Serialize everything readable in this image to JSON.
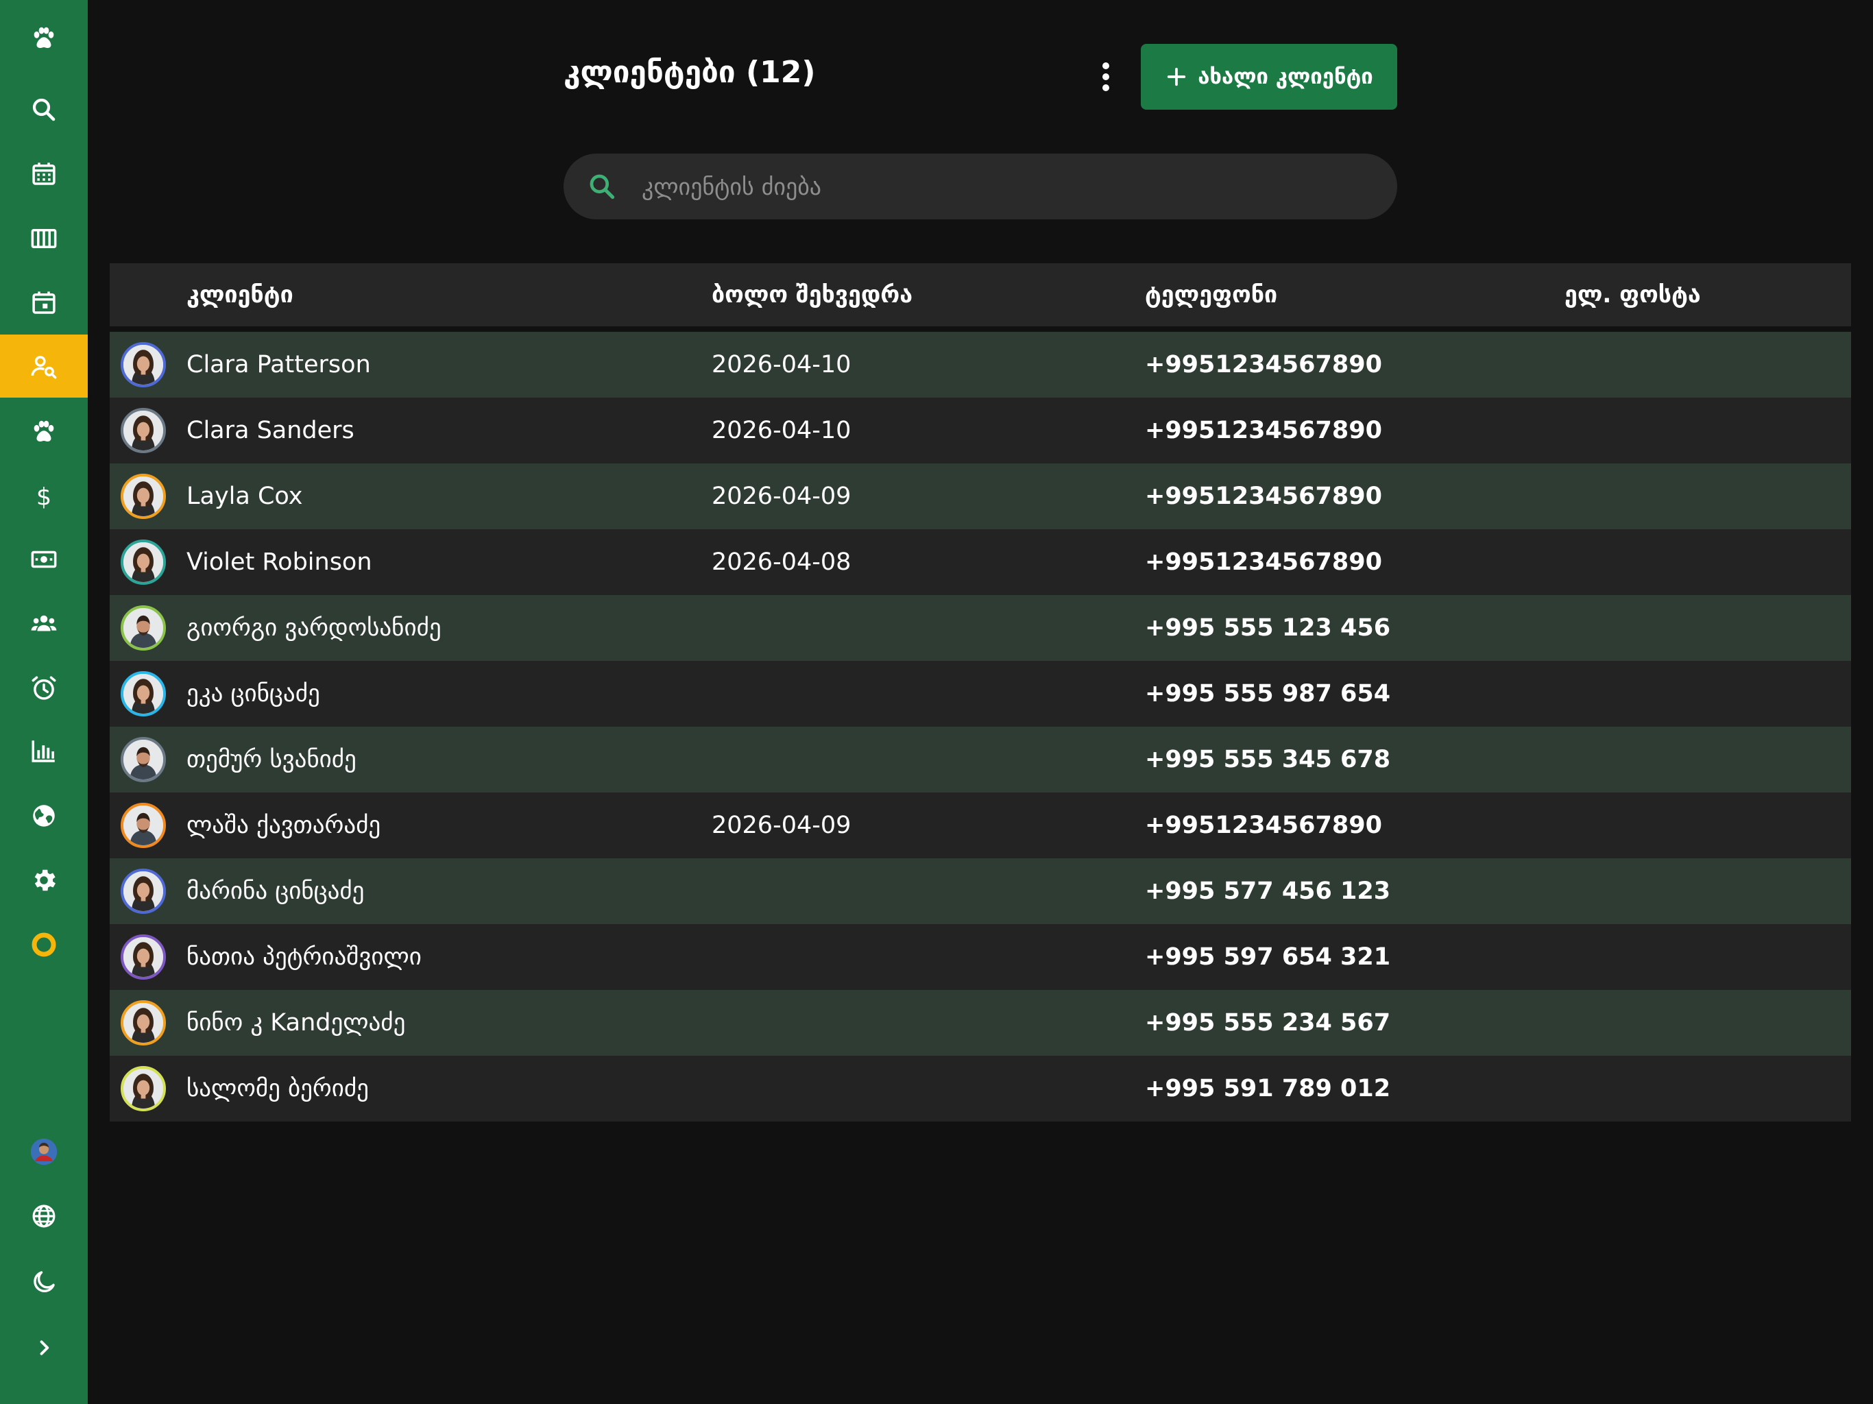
{
  "header": {
    "title": "კლიენტები (12)",
    "add_button_label": "ახალი კლიენტი"
  },
  "search": {
    "placeholder": "კლიენტის ძიება",
    "value": ""
  },
  "sidebar": {
    "items": [
      {
        "icon": "paw-icon",
        "active": false
      },
      {
        "icon": "search-icon",
        "active": false
      },
      {
        "icon": "calendar-grid-icon",
        "active": false
      },
      {
        "icon": "columns-icon",
        "active": false
      },
      {
        "icon": "calendar-event-icon",
        "active": false
      },
      {
        "icon": "client-search-icon",
        "active": true
      },
      {
        "icon": "paw-icon",
        "active": false
      },
      {
        "icon": "dollar-icon",
        "active": false
      },
      {
        "icon": "cash-icon",
        "active": false
      },
      {
        "icon": "group-icon",
        "active": false
      },
      {
        "icon": "alarm-icon",
        "active": false
      },
      {
        "icon": "bar-chart-icon",
        "active": false
      },
      {
        "icon": "globe-icon",
        "active": false
      },
      {
        "icon": "gear-icon",
        "active": false
      },
      {
        "icon": "donut-icon",
        "active": false
      }
    ],
    "bottom": [
      {
        "icon": "avatar"
      },
      {
        "icon": "language-globe-icon"
      },
      {
        "icon": "moon-icon"
      },
      {
        "icon": "chevron-right-icon"
      }
    ]
  },
  "table": {
    "columns": [
      "კლიენტი",
      "ბოლო შეხვედრა",
      "ტელეფონი",
      "ელ. ფოსტა"
    ],
    "rows": [
      {
        "name": "Clara Patterson",
        "last_visit": "2026-04-10",
        "phone": "+9951234567890",
        "email": "",
        "avatar_color": "#4f6ad6",
        "gender": "f"
      },
      {
        "name": "Clara Sanders",
        "last_visit": "2026-04-10",
        "phone": "+9951234567890",
        "email": "",
        "avatar_color": "#6b7a86",
        "gender": "f"
      },
      {
        "name": "Layla Cox",
        "last_visit": "2026-04-09",
        "phone": "+9951234567890",
        "email": "",
        "avatar_color": "#f0a01e",
        "gender": "f"
      },
      {
        "name": "Violet Robinson",
        "last_visit": "2026-04-08",
        "phone": "+9951234567890",
        "email": "",
        "avatar_color": "#2aa598",
        "gender": "f"
      },
      {
        "name": "გიორგი ვარდოსანიძე",
        "last_visit": "",
        "phone": "+995 555 123 456",
        "email": "",
        "avatar_color": "#8bc34a",
        "gender": "m"
      },
      {
        "name": "ეკა ცინცაძე",
        "last_visit": "",
        "phone": "+995 555 987 654",
        "email": "",
        "avatar_color": "#29b6e8",
        "gender": "f"
      },
      {
        "name": "თემურ სვანიძე",
        "last_visit": "",
        "phone": "+995 555 345 678",
        "email": "",
        "avatar_color": "#6b7a86",
        "gender": "m"
      },
      {
        "name": "ლაშა ქავთარაძე",
        "last_visit": "2026-04-09",
        "phone": "+9951234567890",
        "email": "",
        "avatar_color": "#f08a1e",
        "gender": "m"
      },
      {
        "name": "მარინა ცინცაძე",
        "last_visit": "",
        "phone": "+995 577 456 123",
        "email": "",
        "avatar_color": "#4f6ad6",
        "gender": "f"
      },
      {
        "name": "ნათია პეტრიაშვილი",
        "last_visit": "",
        "phone": "+995 597 654 321",
        "email": "",
        "avatar_color": "#7e57c2",
        "gender": "f"
      },
      {
        "name": "ნინო კ Kandელაძე",
        "last_visit": "",
        "phone": "+995 555 234 567",
        "email": "",
        "avatar_color": "#f0a01e",
        "gender": "f"
      },
      {
        "name": "სალომე ბერიძე",
        "last_visit": "",
        "phone": "+995 591 789 012",
        "email": "",
        "avatar_color": "#d4e157",
        "gender": "f"
      }
    ]
  },
  "colors": {
    "sidebar": "#1d7543",
    "active_nav": "#f5b50a",
    "primary_button": "#1c7a45",
    "search_icon": "#3bb273",
    "background": "#111111"
  }
}
